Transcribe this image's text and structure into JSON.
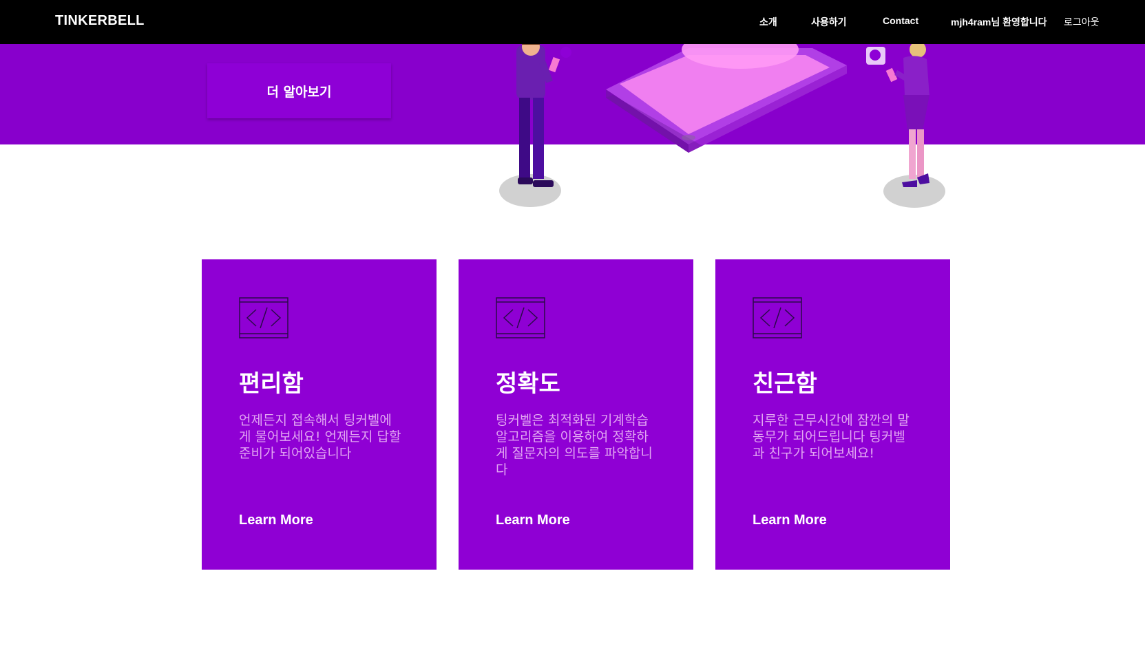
{
  "nav": {
    "brand": "TINKERBELL",
    "links": [
      {
        "label": "소개"
      },
      {
        "label": "사용하기"
      },
      {
        "label": "Contact"
      }
    ],
    "welcome": "mjh4ram님 환영합니다",
    "logout": "로그아웃"
  },
  "hero": {
    "button_label": "더 알아보기",
    "primary_color": "#8800cc"
  },
  "cards": [
    {
      "icon": "code-window-icon",
      "title": "편리함",
      "description": "언제든지 접속해서 팅커벨에게 물어보세요! 언제든지 답할 준비가 되어있습니다",
      "link": "Learn More"
    },
    {
      "icon": "code-window-icon",
      "title": "정확도",
      "description": "팅커벨은 최적화된 기계학습 알고리즘을 이용하여 정확하게 질문자의 의도를 파악합니다",
      "link": "Learn More"
    },
    {
      "icon": "code-window-icon",
      "title": "친근함",
      "description": "지루한 근무시간에 잠깐의 말동무가 되어드립니다 팅커벨과 친구가 되어보세요!",
      "link": "Learn More"
    }
  ],
  "colors": {
    "nav_bg": "#000000",
    "card_bg": "#8f00d4",
    "card_text": "#e2a6f2"
  }
}
